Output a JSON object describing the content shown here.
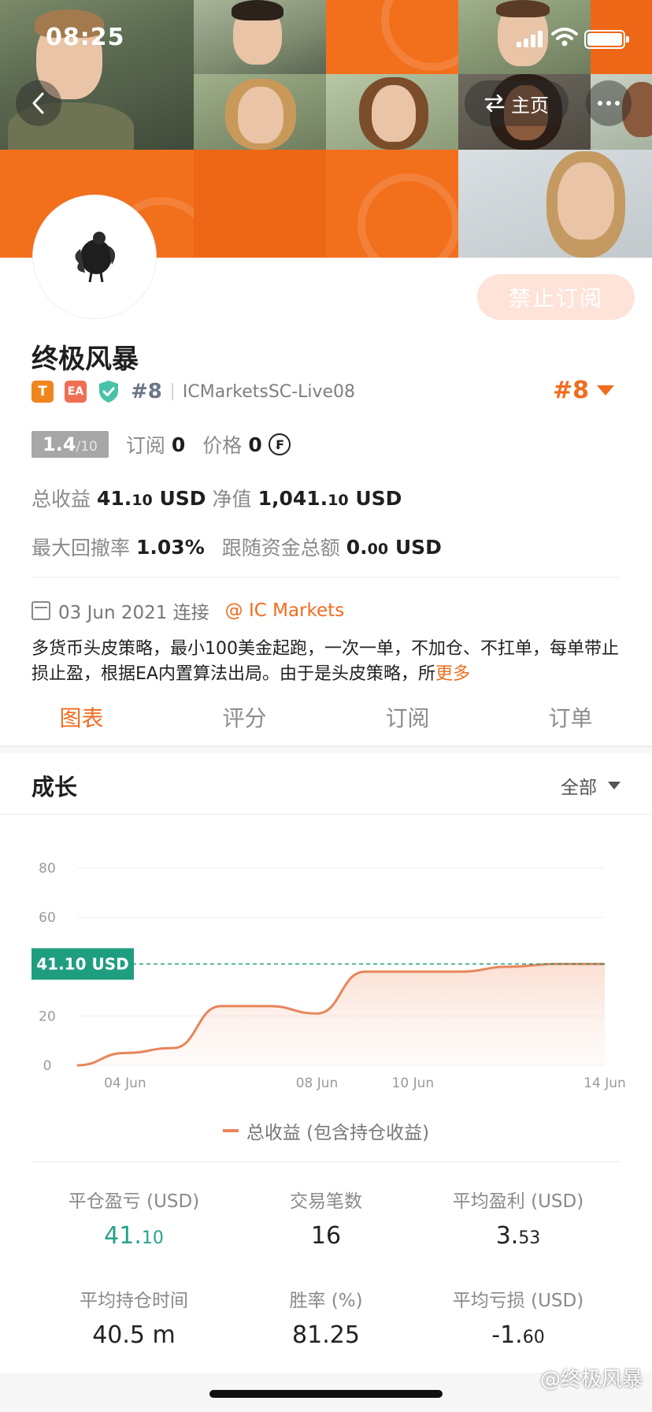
{
  "status_bar": {
    "time": "08:25"
  },
  "nav": {
    "home_label": "主页"
  },
  "profile": {
    "subscribe_button": "禁止订阅",
    "name": "终极风暴",
    "badge_t": "T",
    "badge_ea": "EA",
    "rank_small": "#8",
    "account": "ICMarketsSC-Live08",
    "rank_big": "#8",
    "score_value": "1.4",
    "score_max": "/10",
    "subscribe_label": "订阅",
    "subscribe_count": "0",
    "price_label": "价格",
    "price_value": "0",
    "total_profit_label": "总收益",
    "total_profit_int": "41.",
    "total_profit_dec": "10",
    "total_profit_unit": "USD",
    "equity_label": "净值",
    "equity_int": "1,041.",
    "equity_dec": "10",
    "equity_unit": "USD",
    "max_drawdown_label": "最大回撤率",
    "max_drawdown_value": "1.03%",
    "follow_funds_label": "跟随资金总额",
    "follow_funds_int": "0.",
    "follow_funds_dec": "00",
    "follow_funds_unit": "USD",
    "connect_date": "03 Jun 2021 连接",
    "broker_link": "@ IC Markets",
    "description": "多货币头皮策略，最小100美金起跑，一次一单，不加仓、不扛单，每单带止损止盈，根据EA内置算法出局。由于是头皮策略，所",
    "more_label": "更多"
  },
  "tabs": [
    {
      "label": "图表"
    },
    {
      "label": "评分"
    },
    {
      "label": "订阅"
    },
    {
      "label": "订单"
    }
  ],
  "section": {
    "title": "成长",
    "filter": "全部"
  },
  "chart_data": {
    "type": "area",
    "x": [
      "03 Jun",
      "04 Jun",
      "05 Jun",
      "06 Jun",
      "07 Jun",
      "08 Jun",
      "09 Jun",
      "10 Jun",
      "11 Jun",
      "12 Jun",
      "13 Jun",
      "14 Jun"
    ],
    "series": [
      {
        "name": "总收益 (包含持仓收益)",
        "values": [
          0,
          5,
          7,
          24,
          24,
          21,
          38,
          38,
          38,
          40,
          41.1,
          41.1
        ]
      }
    ],
    "x_tick_labels": [
      "04 Jun",
      "08 Jun",
      "10 Jun",
      "14 Jun"
    ],
    "y_ticks": [
      0,
      20,
      60,
      80
    ],
    "ylim": [
      0,
      85
    ],
    "current_value_label": "41.10 USD",
    "current_value": 41.1,
    "grid": true,
    "colors": {
      "line": "#e8855a",
      "marker": "#1f9e7f"
    }
  },
  "stats": {
    "closed_pnl_label": "平仓盈亏 (USD)",
    "closed_pnl_int": "41.",
    "closed_pnl_dec": "10",
    "trades_label": "交易笔数",
    "trades_value": "16",
    "avg_profit_label": "平均盈利 (USD)",
    "avg_profit_int": "3.",
    "avg_profit_dec": "53",
    "avg_hold_label": "平均持仓时间",
    "avg_hold_value": "40.5 m",
    "win_rate_label": "胜率 (%)",
    "win_rate_value": "81.25",
    "avg_loss_label": "平均亏损 (USD)",
    "avg_loss_int": "-1.",
    "avg_loss_dec": "60"
  },
  "watermark": "@终极风暴",
  "colors": {
    "accent": "#f26c1e",
    "green": "#27a28a",
    "banner": "#f06a1b"
  }
}
